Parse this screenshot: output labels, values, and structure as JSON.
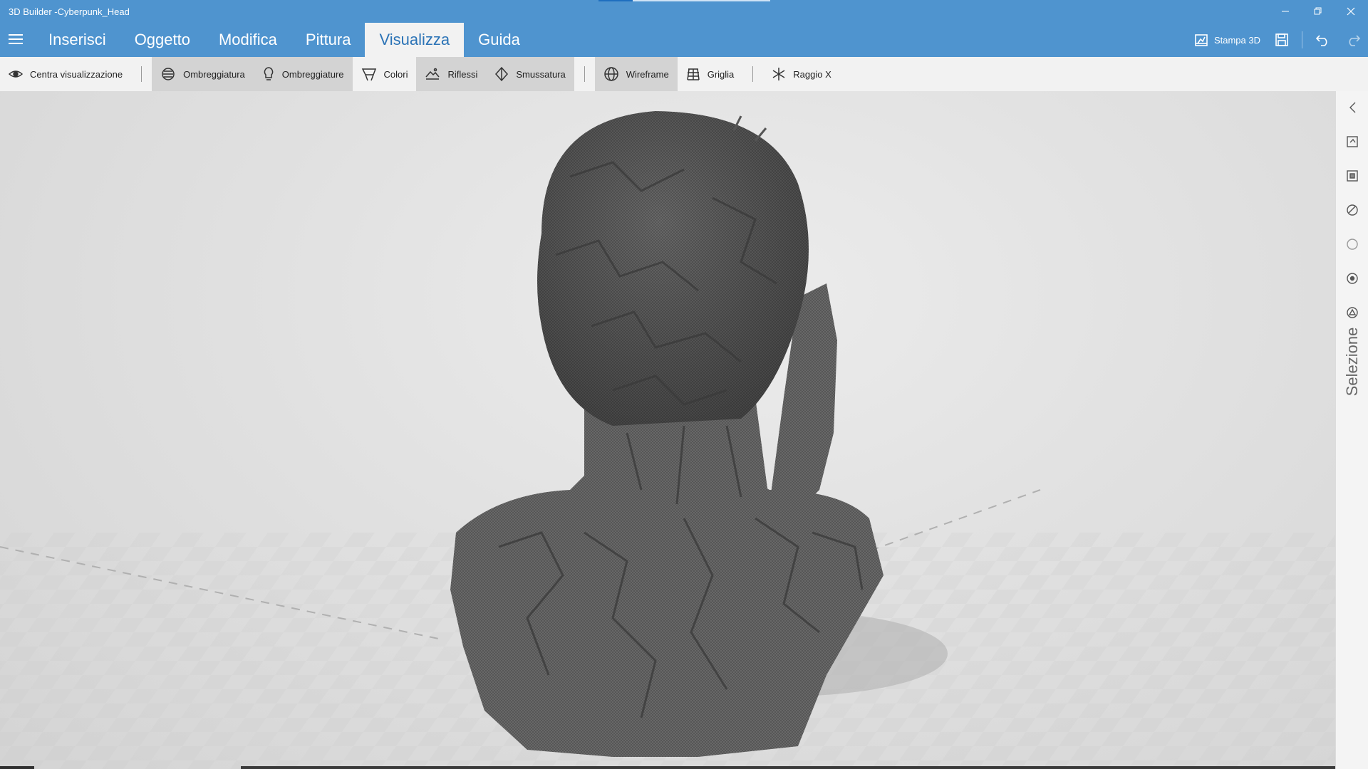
{
  "window": {
    "title": "3D Builder -Cyberpunk_Head",
    "accent": "#4f94cf"
  },
  "ribbon": {
    "tabs": [
      {
        "label": "Inserisci"
      },
      {
        "label": "Oggetto"
      },
      {
        "label": "Modifica"
      },
      {
        "label": "Pittura"
      },
      {
        "label": "Visualizza",
        "active": true
      },
      {
        "label": "Guida"
      }
    ],
    "print_label": "Stampa 3D"
  },
  "toolbar": {
    "center_view": "Centra visualizzazione",
    "shading": "Ombreggiatura",
    "shadows": "Ombreggiature",
    "colors": "Colori",
    "reflections": "Riflessi",
    "smoothing": "Smussatura",
    "wireframe": "Wireframe",
    "grid": "Griglia",
    "xray": "Raggio X"
  },
  "toolbar_state": {
    "shading_on": true,
    "shadows_on": true,
    "colors_on": false,
    "reflections_on": true,
    "smoothing_on": true,
    "wireframe_on": true
  },
  "sidepanel": {
    "label": "Selezione",
    "icons": [
      "chevron-left-icon",
      "select-object-icon",
      "select-face-icon",
      "select-edge-icon",
      "select-vertex-icon",
      "select-mesh-icon",
      "select-triangle-icon"
    ]
  },
  "viewport": {
    "model": "Cyberpunk_Head wireframe bust"
  }
}
